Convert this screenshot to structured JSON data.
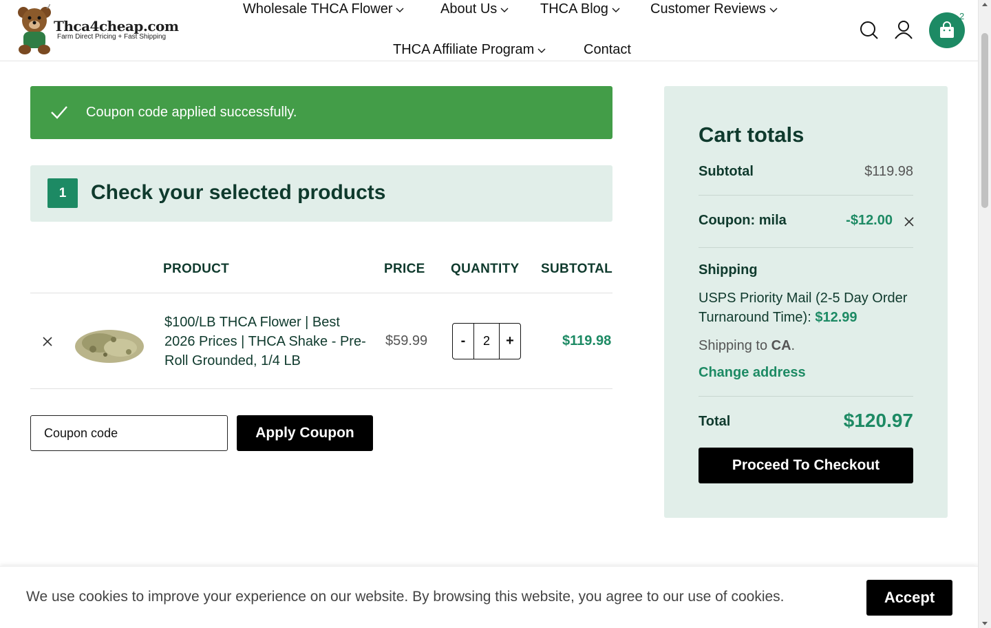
{
  "brand": {
    "name": "Thca4cheap.com",
    "tagline": "Farm Direct Pricing + Fast Shipping",
    "accent_color": "#1d8a64"
  },
  "nav": {
    "items": [
      {
        "label": "Wholesale THCA Flower",
        "has_dropdown": true
      },
      {
        "label": "About Us",
        "has_dropdown": true
      },
      {
        "label": "THCA Blog",
        "has_dropdown": true
      },
      {
        "label": "Customer Reviews",
        "has_dropdown": true
      },
      {
        "label": "THCA Affiliate Program",
        "has_dropdown": true
      },
      {
        "label": "Contact",
        "has_dropdown": false
      }
    ],
    "icons": [
      "search-icon",
      "account-icon",
      "cart-bag-icon"
    ],
    "cart_count": "2"
  },
  "notice": {
    "text": "Coupon code applied successfully.",
    "color": "#439d48"
  },
  "step": {
    "number": "1",
    "title": "Check your selected products"
  },
  "table": {
    "headers": {
      "product": "PRODUCT",
      "price": "PRICE",
      "quantity": "QUANTITY",
      "subtotal": "SUBTOTAL"
    },
    "rows": [
      {
        "name": "$100/LB THCA Flower | Best 2026 Prices | THCA Shake - Pre-Roll Grounded, 1/4 LB",
        "price": "$59.99",
        "quantity": "2",
        "subtotal": "$119.98"
      }
    ],
    "qty_minus": "-",
    "qty_plus": "+"
  },
  "coupon": {
    "placeholder": "Coupon code",
    "button": "Apply Coupon"
  },
  "totals": {
    "title": "Cart totals",
    "subtotal_label": "Subtotal",
    "subtotal_value": "$119.98",
    "coupon_label": "Coupon: mila",
    "coupon_value": "-$12.00",
    "shipping_label": "Shipping",
    "shipping_method": "USPS Priority Mail (2-5 Day Order Turnaround Time):",
    "shipping_price": "$12.99",
    "shipping_to_prefix": "Shipping to",
    "shipping_to_state": "CA",
    "shipping_to_suffix": ".",
    "change_address": "Change address",
    "total_label": "Total",
    "total_value": "$120.97",
    "checkout_button": "Proceed To Checkout"
  },
  "cookie": {
    "text": "We use cookies to improve your experience on our website. By browsing this website, you agree to our use of cookies.",
    "button": "Accept"
  }
}
